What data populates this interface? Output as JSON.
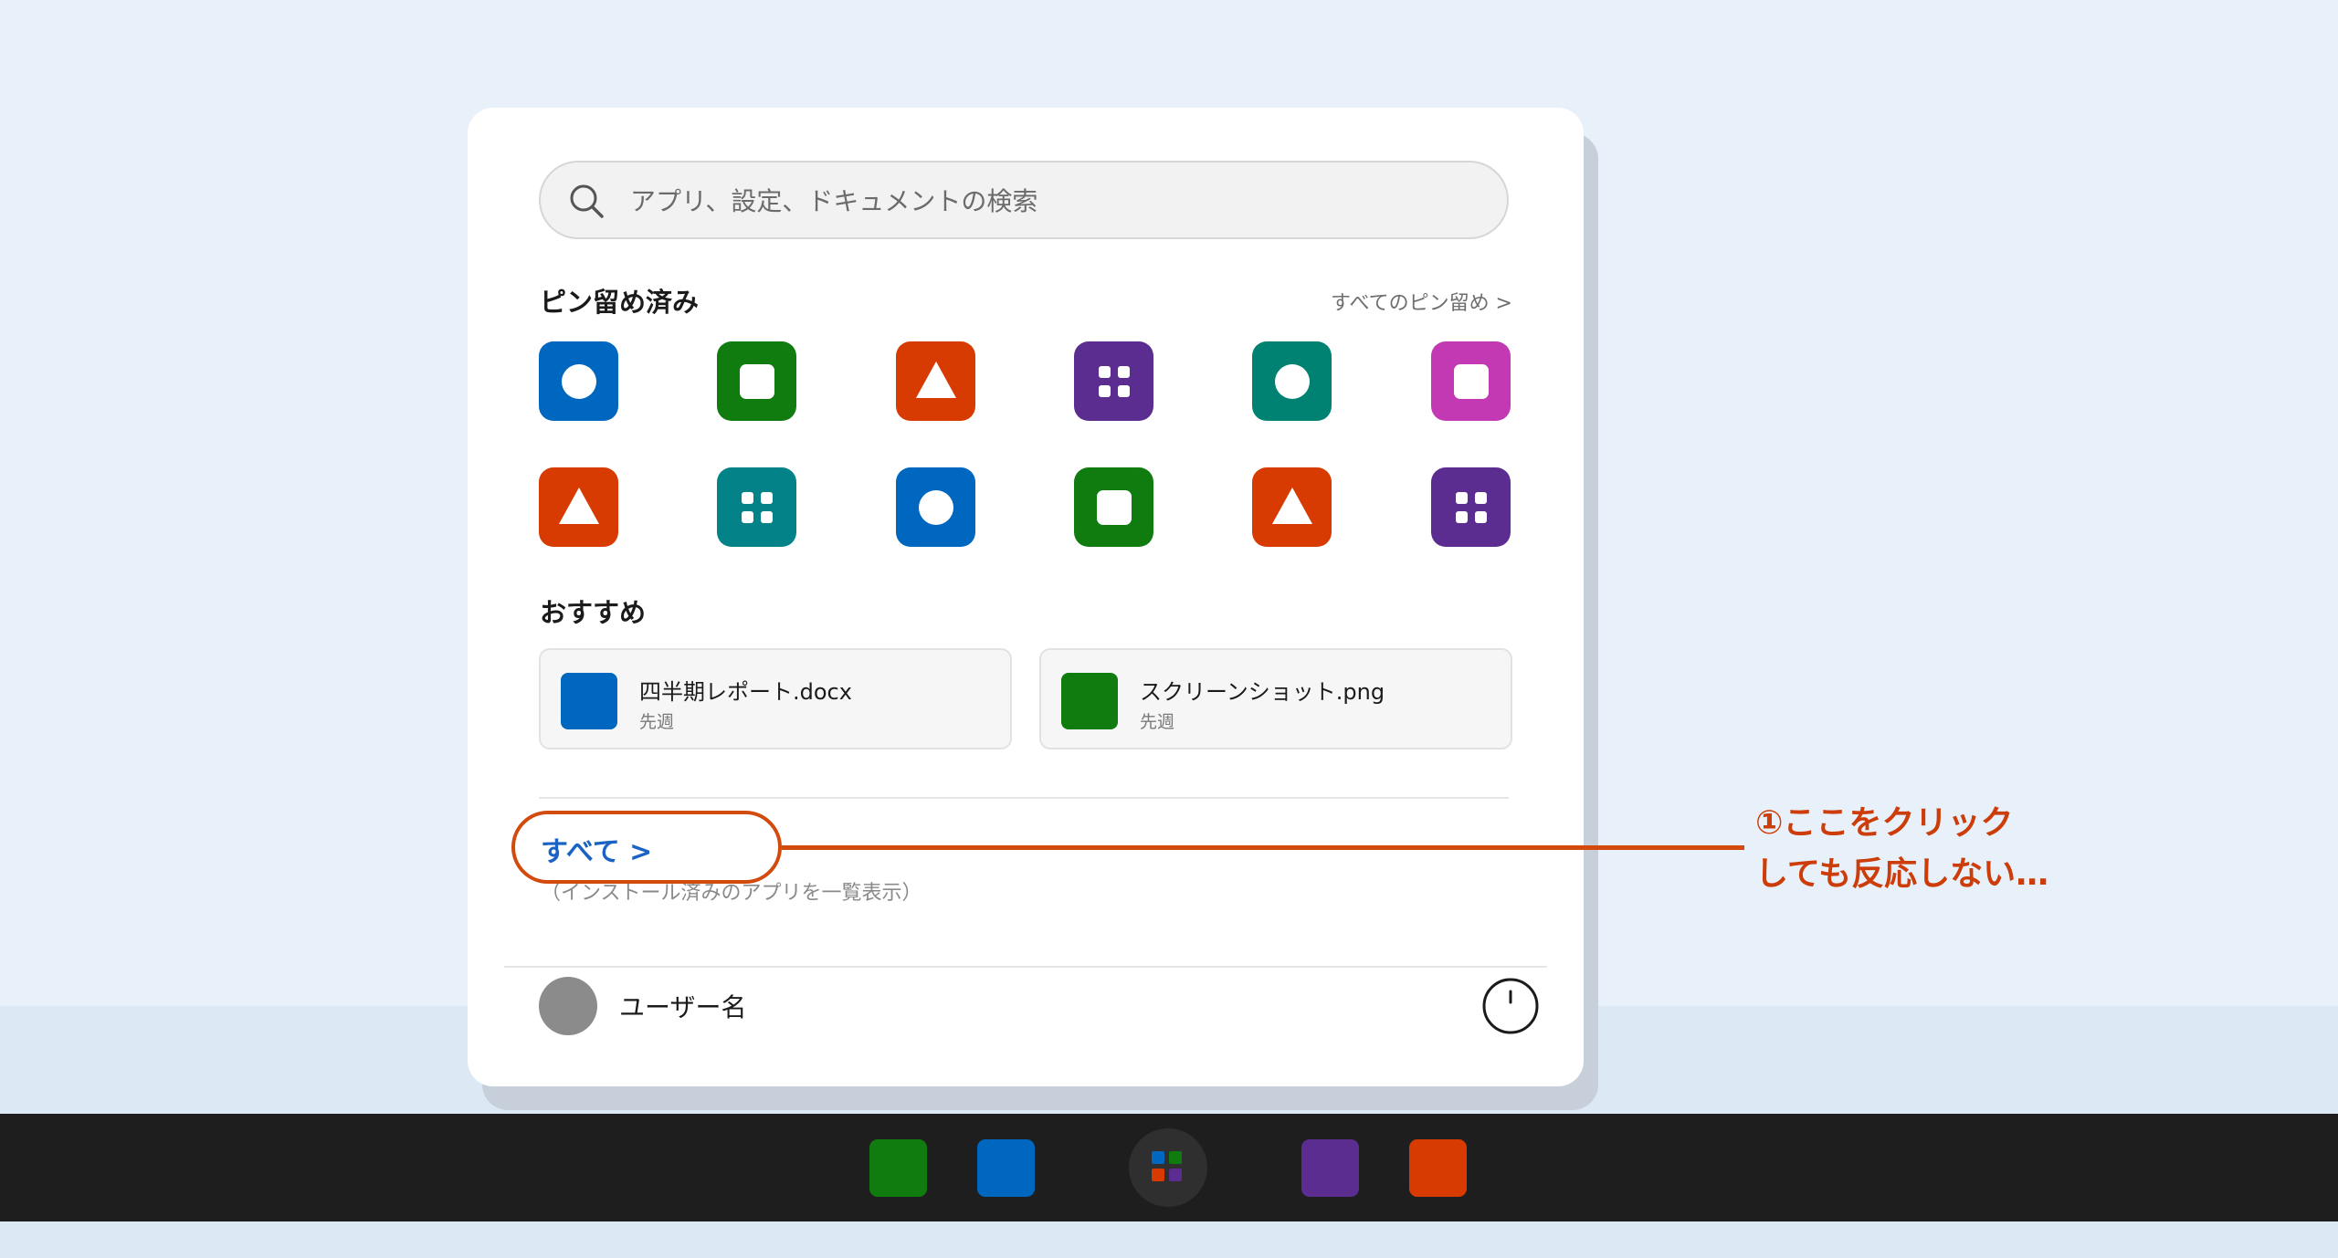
{
  "search": {
    "placeholder": "アプリ、設定、ドキュメントの検索"
  },
  "pinned": {
    "title": "ピン留め済み",
    "all_link": "すべてのピン留め >",
    "apps": [
      {
        "color": "#0067c0",
        "shape": "circle"
      },
      {
        "color": "#107c10",
        "shape": "square"
      },
      {
        "color": "#d83b01",
        "shape": "triangle"
      },
      {
        "color": "#5c2d91",
        "shape": "grid"
      },
      {
        "color": "#008272",
        "shape": "circle"
      },
      {
        "color": "#c239b3",
        "shape": "square"
      },
      {
        "color": "#d83b01",
        "shape": "triangle"
      },
      {
        "color": "#038387",
        "shape": "grid"
      },
      {
        "color": "#0067c0",
        "shape": "circle"
      },
      {
        "color": "#107c10",
        "shape": "square"
      },
      {
        "color": "#d83b01",
        "shape": "triangle"
      },
      {
        "color": "#5c2d91",
        "shape": "grid"
      }
    ]
  },
  "recommended": {
    "title": "おすすめ",
    "items": [
      {
        "name": "四半期レポート.docx",
        "time": "先週",
        "color": "#0067c0"
      },
      {
        "name": "スクリーンショット.png",
        "time": "先週",
        "color": "#107c10"
      }
    ]
  },
  "all_apps": {
    "label": "すべて >",
    "subtitle": "（インストール済みのアプリを一覧表示）"
  },
  "callout": {
    "line1": "①ここをクリック",
    "line2": "しても反応しない…",
    "color": "#d24a0c"
  },
  "user": {
    "name": "ユーザー名"
  },
  "taskbar": {
    "icons": [
      {
        "color": "#107c10"
      },
      {
        "color": "#0067c0"
      },
      {
        "color": "#5c2d91"
      },
      {
        "color": "#d83b01"
      }
    ],
    "start_colors": [
      "#0067c0",
      "#107c10",
      "#d83b01",
      "#5c2d91"
    ]
  }
}
